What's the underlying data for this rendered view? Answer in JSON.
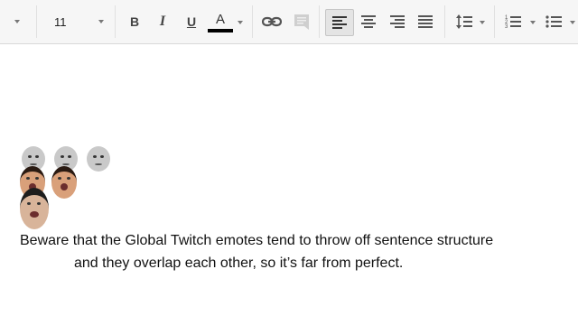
{
  "toolbar": {
    "font_size": "11",
    "bold_label": "B",
    "italic_label": "I",
    "underline_label": "U",
    "text_color_label": "A",
    "text_color": "#000000",
    "icons": [
      "dropdown-caret-icon",
      "link-icon",
      "comment-icon",
      "align-left-icon",
      "align-center-icon",
      "align-right-icon",
      "align-justify-icon",
      "line-spacing-icon",
      "numbered-list-icon",
      "bulleted-list-icon"
    ]
  },
  "document": {
    "emotes": [
      "Kappa",
      "Kappa",
      "Kappa",
      "PogChamp",
      "PogChamp",
      "BibleThump"
    ],
    "line1": "Beware that the Global Twitch emotes tend to throw off sentence structure",
    "line2": "and they overlap each other, so it’s far from perfect."
  }
}
